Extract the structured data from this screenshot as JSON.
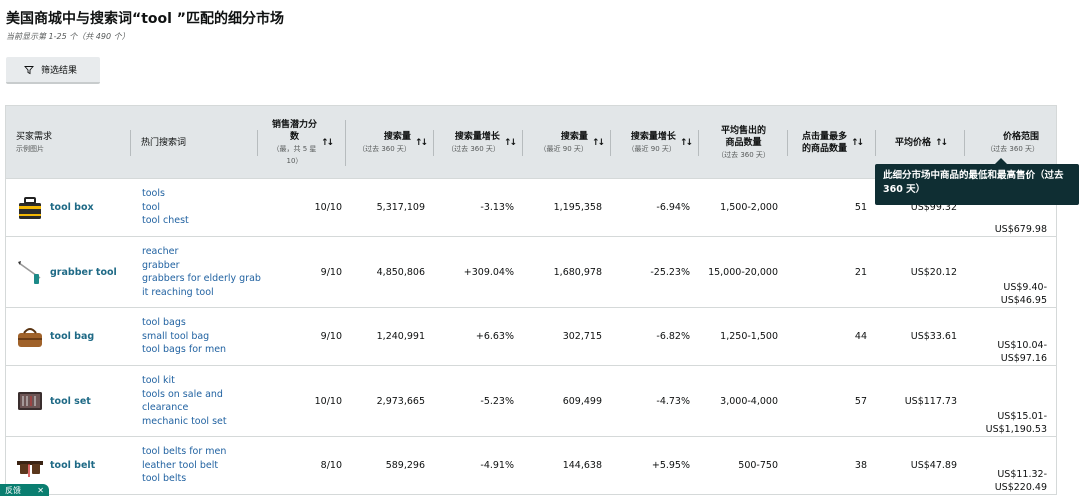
{
  "header": {
    "title": "美国商城中与搜索词“tool ”匹配的细分市场",
    "subtitle": "当前显示第 1-25 个（共 490 个）"
  },
  "filter": {
    "label": "筛选结果",
    "icon": "filter-icon"
  },
  "columns": [
    {
      "main": "买家需求",
      "sub": "示例图片"
    },
    {
      "main": "热门搜索词",
      "sub": ""
    },
    {
      "main": "销售潜力分数",
      "sub": "（最，共 5 星 10）"
    },
    {
      "main": "搜索量",
      "sub": "（过去 360 天）"
    },
    {
      "main": "搜索量增长",
      "sub": "（过去 360 天）"
    },
    {
      "main": "搜索量",
      "sub": "（最近 90 天）"
    },
    {
      "main": "搜索量增长",
      "sub": "（最近 90 天）"
    },
    {
      "main": "平均售出的商品数量",
      "sub": "（过去 360 天）"
    },
    {
      "main": "点击量最多的商品数量",
      "sub": ""
    },
    {
      "main": "平均价格",
      "sub": ""
    },
    {
      "main": "价格范围",
      "sub": "（过去 360 天）"
    }
  ],
  "header_lines": {
    "potential": [
      "销售潜力分",
      "数"
    ],
    "potential_sub": [
      "（最，共 5 星",
      "10）"
    ],
    "avg_sold": [
      "平均售出的",
      "商品数量"
    ],
    "clicked": [
      "点击量最多",
      "的商品数量"
    ]
  },
  "rows": [
    {
      "name": "tool box",
      "icon": "toolbox-image",
      "terms": [
        "tools",
        "tool",
        "tool chest"
      ],
      "potential": "10/10",
      "sv360": "5,317,109",
      "g360": "-3.13%",
      "sv90": "1,195,358",
      "g90": "-6.94%",
      "sold": "1,500-2,000",
      "clicked": "51",
      "avg": "US$99.32",
      "range": [
        "",
        "US$679.98"
      ]
    },
    {
      "name": "grabber tool",
      "icon": "grabber-image",
      "terms": [
        "reacher",
        "grabber",
        "grabbers for elderly grab",
        "it reaching tool"
      ],
      "potential": "9/10",
      "sv360": "4,850,806",
      "g360": "+309.04%",
      "sv90": "1,680,978",
      "g90": "-25.23%",
      "sold": "15,000-20,000",
      "clicked": "21",
      "avg": "US$20.12",
      "range": [
        "US$9.40-",
        "US$46.95"
      ]
    },
    {
      "name": "tool bag",
      "icon": "toolbag-image",
      "terms": [
        "tool bags",
        "small tool bag",
        "tool bags for men"
      ],
      "potential": "9/10",
      "sv360": "1,240,991",
      "g360": "+6.63%",
      "sv90": "302,715",
      "g90": "-6.82%",
      "sold": "1,250-1,500",
      "clicked": "44",
      "avg": "US$33.61",
      "range": [
        "US$10.04-",
        "US$97.16"
      ]
    },
    {
      "name": "tool set",
      "icon": "toolset-image",
      "terms": [
        "tool kit",
        "tools on sale and",
        "clearance",
        "mechanic tool set"
      ],
      "potential": "10/10",
      "sv360": "2,973,665",
      "g360": "-5.23%",
      "sv90": "609,499",
      "g90": "-4.73%",
      "sold": "3,000-4,000",
      "clicked": "57",
      "avg": "US$117.73",
      "range": [
        "US$15.01-",
        "US$1,190.53"
      ]
    },
    {
      "name": "tool belt",
      "icon": "toolbelt-image",
      "terms": [
        "tool belts for men",
        "leather tool belt",
        "tool belts"
      ],
      "potential": "8/10",
      "sv360": "589,296",
      "g360": "-4.91%",
      "sv90": "144,638",
      "g90": "+5.95%",
      "sold": "500-750",
      "clicked": "38",
      "avg": "US$47.89",
      "range": [
        "US$11.32-",
        "US$220.49"
      ]
    }
  ],
  "tooltip": {
    "lines": [
      "此细分市场中商品的最低和最高售价（过去",
      "360 天）"
    ]
  },
  "feedback": {
    "label": "反馈",
    "close": "✕"
  }
}
